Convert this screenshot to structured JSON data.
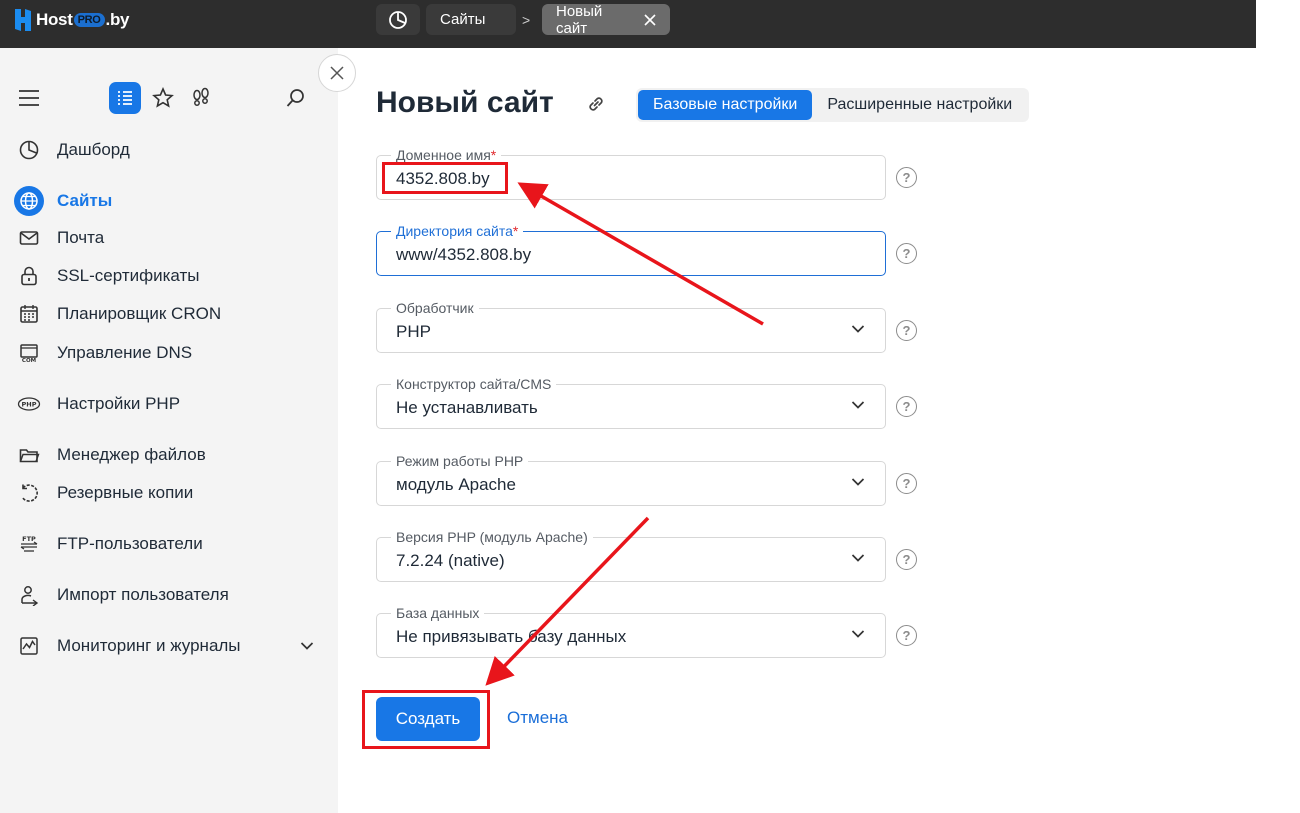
{
  "brand": {
    "host": "Host",
    "pro": "PRO",
    "by": ".by"
  },
  "topbar": {
    "tabs": [
      {
        "label": "Сайты"
      },
      {
        "label": "Новый сайт"
      }
    ],
    "separator": ">"
  },
  "sidebar": {
    "items": [
      {
        "label": "Дашборд",
        "icon": "dashboard-icon"
      },
      {
        "label": "Сайты",
        "icon": "globe-icon",
        "active": true
      },
      {
        "label": "Почта",
        "icon": "mail-icon"
      },
      {
        "label": "SSL-сертификаты",
        "icon": "lock-icon"
      },
      {
        "label": "Планировщик CRON",
        "icon": "calendar-icon"
      },
      {
        "label": "Управление DNS",
        "icon": "dns-icon"
      },
      {
        "label": "Настройки PHP",
        "icon": "php-icon"
      },
      {
        "label": "Менеджер файлов",
        "icon": "folder-icon"
      },
      {
        "label": "Резервные копии",
        "icon": "backup-icon"
      },
      {
        "label": "FTP-пользователи",
        "icon": "ftp-icon"
      },
      {
        "label": "Импорт пользователя",
        "icon": "user-import-icon"
      },
      {
        "label": "Мониторинг и журналы",
        "icon": "monitoring-icon"
      }
    ]
  },
  "main": {
    "title": "Новый сайт",
    "tabs": [
      {
        "label": "Базовые настройки",
        "active": true
      },
      {
        "label": "Расширенные настройки"
      }
    ],
    "fields": [
      {
        "label": "Доменное имя",
        "required": "*",
        "value": "4352.808.by"
      },
      {
        "label": "Директория сайта",
        "required": "*",
        "value": "www/4352.808.by"
      },
      {
        "label": "Обработчик",
        "value": "PHP"
      },
      {
        "label": "Конструктор сайта/CMS",
        "value": "Не устанавливать"
      },
      {
        "label": "Режим работы PHP",
        "value": "модуль Apache"
      },
      {
        "label": "Версия PHP (модуль Apache)",
        "value": "7.2.24 (native)"
      },
      {
        "label": "База данных",
        "value": "Не привязывать базу данных"
      }
    ],
    "help": "?",
    "create_label": "Создать",
    "cancel_label": "Отмена"
  },
  "colors": {
    "accent": "#1877e6",
    "topbar": "#2d2d2d",
    "annotation": "#e8151b"
  }
}
